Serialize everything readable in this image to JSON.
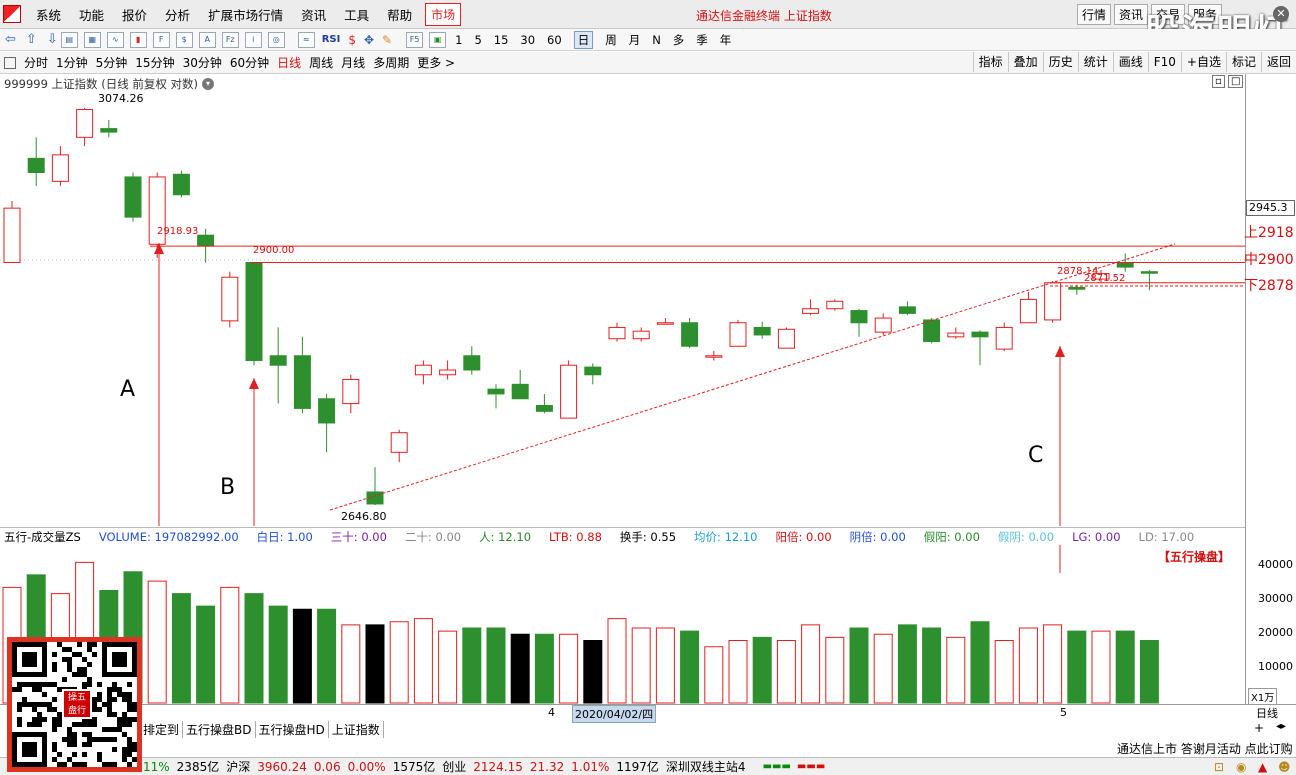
{
  "menubar": {
    "logo_icon": "tdx-logo-icon",
    "items": [
      "系统",
      "功能",
      "报价",
      "分析",
      "扩展市场行情",
      "资讯",
      "工具",
      "帮助"
    ],
    "market_tab": "市场",
    "window_title": "通达信金融终端 上证指数",
    "right_buttons": [
      "行情",
      "资讯",
      "交易",
      "服务"
    ],
    "watermark": "股海明灯"
  },
  "toolbar": {
    "periods": [
      "1",
      "5",
      "15",
      "30",
      "60"
    ],
    "period_words": [
      "日",
      "周",
      "月",
      "N",
      "多",
      "季",
      "年"
    ]
  },
  "periodbar": {
    "items": [
      "分时",
      "1分钟",
      "5分钟",
      "15分钟",
      "30分钟",
      "60分钟",
      "日线",
      "周线",
      "月线",
      "多周期",
      "更多 >"
    ],
    "active": "日线",
    "right": [
      "指标",
      "叠加",
      "历史",
      "统计",
      "画线",
      "F10",
      "+自选",
      "标记",
      "返回"
    ]
  },
  "chart": {
    "title": "999999 上证指数 (日线 前复权 对数)",
    "high_label": "3074.26",
    "low_label": "2646.80",
    "level_2918": "2918.93",
    "level_2900": "2900.00",
    "level_2878": "2878.14",
    "level_2871": "2871.52",
    "right_labels": {
      "top": "2945.3",
      "upper": "上2918",
      "mid": "中2900",
      "lower": "下2878"
    },
    "annotations": {
      "A": "A",
      "B": "B",
      "C": "C"
    },
    "brand_label": "【五行操盘】"
  },
  "indicator": {
    "name": "五行-成交量ZS",
    "items": [
      {
        "t": "VOLUME: 197082992.00",
        "c": "#1f4fd0"
      },
      {
        "t": "白日: 1.00",
        "c": "#1f4fd0"
      },
      {
        "t": "三十: 0.00",
        "c": "#7a1fa0"
      },
      {
        "t": "二十: 0.00",
        "c": "#888888"
      },
      {
        "t": "人: 12.10",
        "c": "#2a8a2a"
      },
      {
        "t": "LTB: 0.88",
        "c": "#d01010"
      },
      {
        "t": "换手: 0.55",
        "c": "#000000"
      },
      {
        "t": "均价: 12.10",
        "c": "#1a9ed0"
      },
      {
        "t": "阳倍: 0.00",
        "c": "#d01010"
      },
      {
        "t": "阴倍: 0.00",
        "c": "#1f4fd0"
      },
      {
        "t": "假阳: 0.00",
        "c": "#2a8a2a"
      },
      {
        "t": "假阴: 0.00",
        "c": "#5bc0de"
      },
      {
        "t": "LG: 0.00",
        "c": "#7a1fa0"
      },
      {
        "t": "LD: 17.00",
        "c": "#888888"
      }
    ]
  },
  "vol_axis": {
    "ticks": [
      "40000",
      "30000",
      "20000",
      "10000"
    ],
    "unit": "X1万"
  },
  "timeaxis": {
    "m4": "4",
    "date": "2020/04/02/四",
    "m5": "5",
    "right": "日线"
  },
  "bottom_tabs": [
    "排定到",
    "五行操盘BD",
    "五行操盘HD",
    "上证指数"
  ],
  "notice": "通达信上市 答谢月活动 点此订购",
  "status": [
    {
      "t": "11%",
      "c": "#0a8a0a"
    },
    {
      "t": "2385亿",
      "c": "#000"
    },
    {
      "t": "沪深",
      "c": "#000"
    },
    {
      "t": "3960.24",
      "c": "#d01010"
    },
    {
      "t": "0.06",
      "c": "#d01010"
    },
    {
      "t": "0.00%",
      "c": "#d01010"
    },
    {
      "t": "1575亿",
      "c": "#000"
    },
    {
      "t": "创业",
      "c": "#000"
    },
    {
      "t": "2124.15",
      "c": "#d01010"
    },
    {
      "t": "21.32",
      "c": "#d01010"
    },
    {
      "t": "1.01%",
      "c": "#d01010"
    },
    {
      "t": "1197亿",
      "c": "#000"
    },
    {
      "t": "深圳双线主站4",
      "c": "#000"
    }
  ],
  "chart_data": {
    "type": "candlestick",
    "title": "999999 上证指数 (日线 前复权 对数)",
    "candles": [
      {
        "o": 2900,
        "c": 2960,
        "h": 2968,
        "l": 2900
      },
      {
        "o": 3016,
        "c": 3000,
        "h": 3040,
        "l": 2985
      },
      {
        "o": 2990,
        "c": 3020,
        "h": 3030,
        "l": 2985
      },
      {
        "o": 3040,
        "c": 3072,
        "h": 3074,
        "l": 3030
      },
      {
        "o": 3050,
        "c": 3046,
        "h": 3060,
        "l": 3040
      },
      {
        "o": 2995,
        "c": 2950,
        "h": 3000,
        "l": 2945
      },
      {
        "o": 2920,
        "c": 2995,
        "h": 3000,
        "l": 2905
      },
      {
        "o": 2998,
        "c": 2975,
        "h": 3002,
        "l": 2972
      },
      {
        "o": 2930,
        "c": 2918,
        "h": 2937,
        "l": 2900
      },
      {
        "o": 2837,
        "c": 2884,
        "h": 2890,
        "l": 2830
      },
      {
        "o": 2900,
        "c": 2795,
        "h": 2900,
        "l": 2790
      },
      {
        "o": 2800,
        "c": 2790,
        "h": 2830,
        "l": 2750
      },
      {
        "o": 2800,
        "c": 2745,
        "h": 2820,
        "l": 2740
      },
      {
        "o": 2755,
        "c": 2730,
        "h": 2760,
        "l": 2700
      },
      {
        "o": 2750,
        "c": 2775,
        "h": 2780,
        "l": 2740
      },
      {
        "o": 2660,
        "c": 2648,
        "h": 2685,
        "l": 2647
      },
      {
        "o": 2700,
        "c": 2720,
        "h": 2723,
        "l": 2690
      },
      {
        "o": 2780,
        "c": 2790,
        "h": 2795,
        "l": 2770
      },
      {
        "o": 2780,
        "c": 2785,
        "h": 2795,
        "l": 2775
      },
      {
        "o": 2800,
        "c": 2785,
        "h": 2810,
        "l": 2780
      },
      {
        "o": 2765,
        "c": 2760,
        "h": 2770,
        "l": 2745
      },
      {
        "o": 2770,
        "c": 2755,
        "h": 2785,
        "l": 2755
      },
      {
        "o": 2748,
        "c": 2742,
        "h": 2760,
        "l": 2740
      },
      {
        "o": 2735,
        "c": 2790,
        "h": 2795,
        "l": 2735
      },
      {
        "o": 2788,
        "c": 2780,
        "h": 2792,
        "l": 2770
      },
      {
        "o": 2818,
        "c": 2830,
        "h": 2835,
        "l": 2815
      },
      {
        "o": 2818,
        "c": 2826,
        "h": 2830,
        "l": 2815
      },
      {
        "o": 2835,
        "c": 2835,
        "h": 2840,
        "l": 2835
      },
      {
        "o": 2835,
        "c": 2810,
        "h": 2840,
        "l": 2808
      },
      {
        "o": 2800,
        "c": 2800,
        "h": 2805,
        "l": 2795
      },
      {
        "o": 2810,
        "c": 2835,
        "h": 2838,
        "l": 2810
      },
      {
        "o": 2830,
        "c": 2822,
        "h": 2836,
        "l": 2818
      },
      {
        "o": 2808,
        "c": 2828,
        "h": 2830,
        "l": 2808
      },
      {
        "o": 2845,
        "c": 2850,
        "h": 2860,
        "l": 2843
      },
      {
        "o": 2850,
        "c": 2858,
        "h": 2860,
        "l": 2848
      },
      {
        "o": 2848,
        "c": 2835,
        "h": 2850,
        "l": 2820
      },
      {
        "o": 2825,
        "c": 2840,
        "h": 2845,
        "l": 2822
      },
      {
        "o": 2852,
        "c": 2845,
        "h": 2858,
        "l": 2843
      },
      {
        "o": 2838,
        "c": 2815,
        "h": 2840,
        "l": 2813
      },
      {
        "o": 2820,
        "c": 2824,
        "h": 2830,
        "l": 2818
      },
      {
        "o": 2825,
        "c": 2820,
        "h": 2827,
        "l": 2790
      },
      {
        "o": 2807,
        "c": 2830,
        "h": 2835,
        "l": 2805
      },
      {
        "o": 2835,
        "c": 2860,
        "h": 2868,
        "l": 2835
      },
      {
        "o": 2838,
        "c": 2878,
        "h": 2880,
        "l": 2835
      },
      {
        "o": 2873,
        "c": 2871,
        "h": 2876,
        "l": 2865
      },
      {
        "o": 2882,
        "c": 2888,
        "h": 2892,
        "l": 2878
      },
      {
        "o": 2900,
        "c": 2895,
        "h": 2910,
        "l": 2890
      },
      {
        "o": 2890,
        "c": 2889,
        "h": 2892,
        "l": 2870
      }
    ],
    "volumes": [
      37,
      41,
      35,
      45,
      36,
      42,
      39,
      35,
      31,
      37,
      35,
      31,
      30,
      30,
      25,
      25,
      26,
      27,
      23,
      24,
      24,
      22,
      22,
      22,
      20,
      27,
      24,
      24,
      23,
      18,
      20,
      21,
      20,
      25,
      21,
      24,
      22,
      25,
      24,
      21,
      26,
      20,
      24,
      25,
      23,
      23,
      23,
      20
    ],
    "levels": [
      2918,
      2900,
      2878
    ],
    "yrange": [
      2640,
      3090
    ],
    "vol_range": [
      0,
      48000
    ]
  }
}
